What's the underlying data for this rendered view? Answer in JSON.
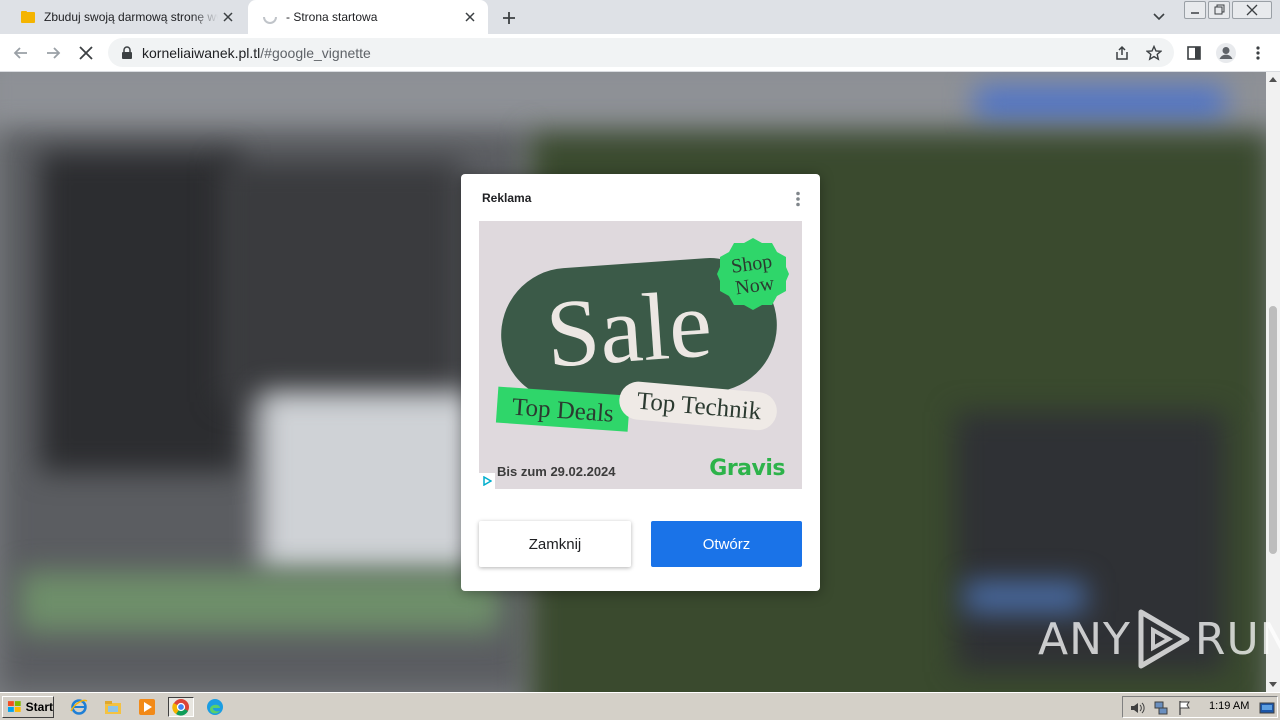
{
  "browser": {
    "tabs": [
      {
        "title": "Zbuduj swoją darmową stronę www",
        "active": false
      },
      {
        "title": "- Strona startowa",
        "active": true
      }
    ],
    "url_host": "korneliaiwanek.pl.tl",
    "url_path": "/#google_vignette"
  },
  "modal": {
    "label": "Reklama",
    "close_button": "Zamknij",
    "open_button": "Otwórz"
  },
  "ad": {
    "headline": "Sale",
    "badge_line1": "Shop",
    "badge_line2": "Now",
    "tag_left": "Top Deals",
    "tag_right": "Top Technik",
    "date_text": "Bis zum 29.02.2024",
    "brand": "Gravis",
    "colors": {
      "pill": "#3b5a48",
      "green": "#2fd66a",
      "background": "#dfd9dd",
      "brand": "#2db34a"
    }
  },
  "watermark": {
    "left": "ANY",
    "right": "RUN"
  },
  "taskbar": {
    "start_label": "Start",
    "clock": "1:19 AM"
  }
}
